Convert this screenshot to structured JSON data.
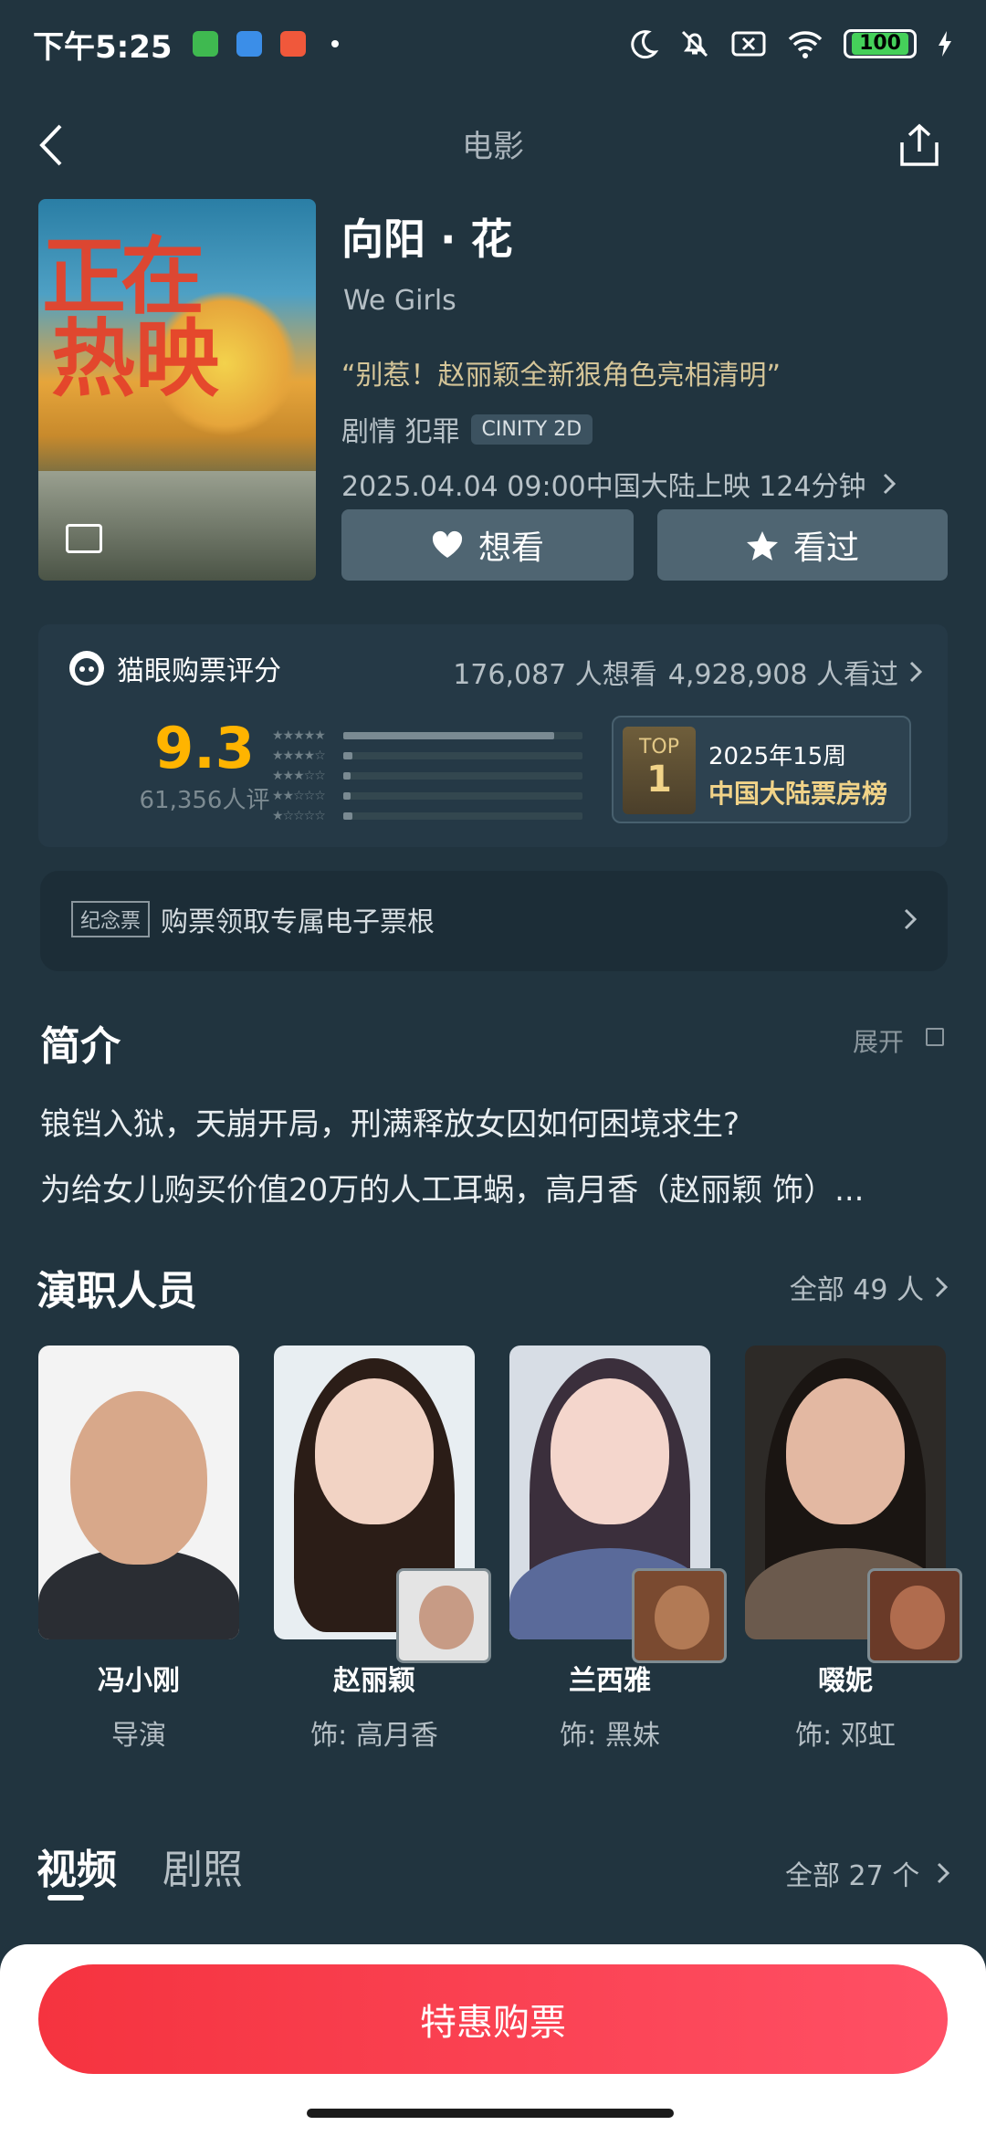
{
  "status_bar": {
    "time": "下午5:25",
    "battery": "100"
  },
  "header": {
    "title": "电影"
  },
  "movie": {
    "title": "向阳 · 花",
    "english_title": "We Girls",
    "tagline": "“别惹！赵丽颖全新狠角色亮相清明”",
    "genres": "剧情 犯罪",
    "format_badge": "CINITY 2D",
    "release_info": "2025.04.04 09:00中国大陆上映 124分钟",
    "poster_text_1": "正在",
    "poster_text_2": "热映"
  },
  "actions": {
    "want": "想看",
    "seen": "看过"
  },
  "rating": {
    "label": "猫眼购票评分",
    "want_count": "176,087 人想看",
    "seen_count": "4,928,908 人看过",
    "score": "9.3",
    "score_count": "61,356人评",
    "distribution": [
      0.88,
      0.04,
      0.02,
      0.02,
      0.04
    ],
    "rank_top": "TOP",
    "rank_number": "1",
    "rank_period": "2025年15周",
    "rank_name": "中国大陆票房榜"
  },
  "ticket_banner": {
    "tag": "纪念票",
    "text": "购票领取专属电子票根"
  },
  "synopsis": {
    "title": "简介",
    "expand": "展开",
    "line1": "锒铛入狱，天崩开局，刑满释放女囚如何困境求生?",
    "line2": "为给女儿购买价值20万的人工耳蜗，高月香（赵丽颖 饰）..."
  },
  "cast": {
    "title": "演职人员",
    "all": "全部 49 人",
    "members": [
      {
        "name": "冯小刚",
        "role": "导演"
      },
      {
        "name": "赵丽颖",
        "role": "饰: 高月香"
      },
      {
        "name": "兰西雅",
        "role": "饰: 黑妹"
      },
      {
        "name": "啜妮",
        "role": "饰: 邓虹"
      }
    ]
  },
  "videos": {
    "tab_video": "视频",
    "tab_stills": "剧照",
    "all": "全部 27 个"
  },
  "buy": {
    "label": "特惠购票"
  },
  "colors": {
    "accent_red": "#f5333f",
    "score_yellow": "#ffb400",
    "bg": "#21343f"
  }
}
